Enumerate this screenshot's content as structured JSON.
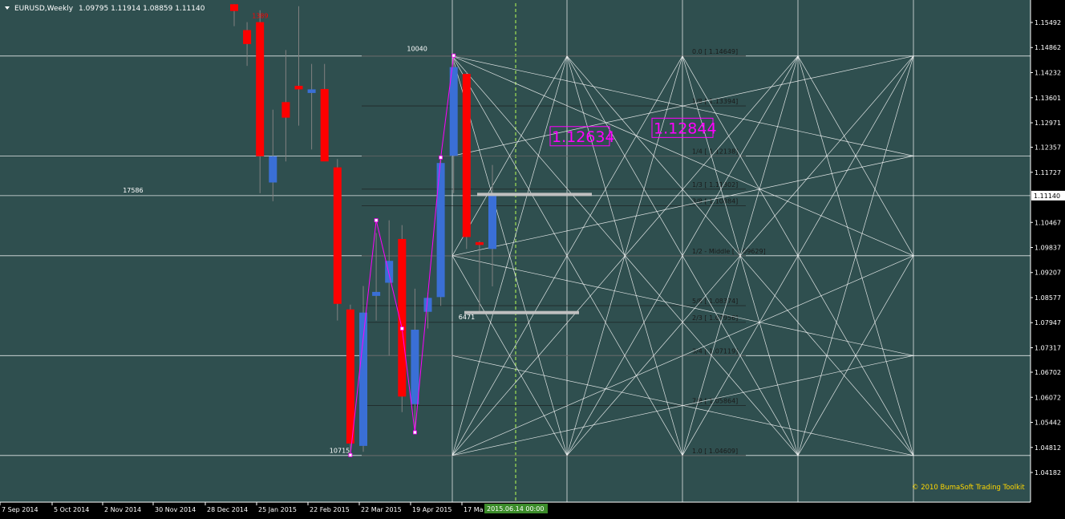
{
  "title": "EURUSD,Weekly",
  "ohlc_values": "1.09795 1.11914 1.08859 1.11140",
  "copyright": "© 2010 BumaSoft Trading Toolkit",
  "colors": {
    "background": "#2f4f4f",
    "grid": "#ffffff",
    "bull": "#3a6fd6",
    "bear": "#ff0000",
    "zigzag": "#ff00ff",
    "vline": "#b7ff55",
    "copyright": "#ffd700",
    "fibo": "#1a1a1a",
    "ask_tag_bg": "#ffffff",
    "date_tag_bg": "#3c8c2a"
  },
  "chart_data": {
    "type": "candlestick",
    "symbol": "EURUSD",
    "timeframe": "Weekly",
    "ylim": [
      1.041,
      1.1595
    ],
    "y_ticks": [
      "1.15492",
      "1.14862",
      "1.14232",
      "1.13601",
      "1.12971",
      "1.12357",
      "1.11727",
      "1.11140",
      "1.10467",
      "1.09837",
      "1.09207",
      "1.08577",
      "1.07947",
      "1.07317",
      "1.06702",
      "1.06072",
      "1.05442",
      "1.04812",
      "1.04182"
    ],
    "x_ticks": [
      "7 Sep 2014",
      "5 Oct 2014",
      "2 Nov 2014",
      "30 Nov 2014",
      "28 Dec 2014",
      "25 Jan 2015",
      "22 Feb 2015",
      "22 Mar 2015",
      "19 Apr 2015",
      "17 Ma"
    ],
    "current_price": "1.11140",
    "date_marker": "2015.06.14 00:00",
    "candles": [
      {
        "o": 1.1595,
        "h": 1.1595,
        "l": 1.154,
        "c": 1.1578
      },
      {
        "o": 1.153,
        "h": 1.155,
        "l": 1.144,
        "c": 1.1495
      },
      {
        "o": 1.155,
        "h": 1.158,
        "l": 1.112,
        "c": 1.1213
      },
      {
        "o": 1.1147,
        "h": 1.133,
        "l": 1.11,
        "c": 1.1213
      },
      {
        "o": 1.1349,
        "h": 1.148,
        "l": 1.12,
        "c": 1.131
      },
      {
        "o": 1.139,
        "h": 1.159,
        "l": 1.129,
        "c": 1.1381
      },
      {
        "o": 1.1372,
        "h": 1.1445,
        "l": 1.123,
        "c": 1.1381
      },
      {
        "o": 1.1382,
        "h": 1.1445,
        "l": 1.124,
        "c": 1.12
      },
      {
        "o": 1.1185,
        "h": 1.1206,
        "l": 1.08,
        "c": 1.0842
      },
      {
        "o": 1.0828,
        "h": 1.084,
        "l": 1.0462,
        "c": 1.0491
      },
      {
        "o": 1.0485,
        "h": 1.0887,
        "l": 1.047,
        "c": 1.082
      },
      {
        "o": 1.0862,
        "h": 1.102,
        "l": 1.08,
        "c": 1.0872
      },
      {
        "o": 1.0895,
        "h": 1.1052,
        "l": 1.0712,
        "c": 1.095
      },
      {
        "o": 1.1005,
        "h": 1.104,
        "l": 1.057,
        "c": 1.0609
      },
      {
        "o": 1.059,
        "h": 1.088,
        "l": 1.0519,
        "c": 1.0777
      },
      {
        "o": 1.0822,
        "h": 1.087,
        "l": 1.078,
        "c": 1.0857
      },
      {
        "o": 1.0859,
        "h": 1.121,
        "l": 1.0837,
        "c": 1.1196
      },
      {
        "o": 1.1214,
        "h": 1.1466,
        "l": 1.112,
        "c": 1.1437
      },
      {
        "o": 1.142,
        "h": 1.1425,
        "l": 1.098,
        "c": 1.101
      },
      {
        "o": 1.0997,
        "h": 1.1,
        "l": 1.0819,
        "c": 1.099
      },
      {
        "o": 1.098,
        "h": 1.1191,
        "l": 1.0886,
        "c": 1.1114
      }
    ],
    "zigzag": [
      {
        "i": 9,
        "price": 1.0462
      },
      {
        "i": 11,
        "price": 1.1052
      },
      {
        "i": 13,
        "price": 1.078
      },
      {
        "i": 14,
        "price": 1.0519
      },
      {
        "i": 16,
        "price": 1.121
      },
      {
        "i": 17,
        "price": 1.1466
      }
    ],
    "annotations": [
      {
        "text": "1389",
        "i": 2,
        "price": 1.1552,
        "color": "#ff0000"
      },
      {
        "text": "10040",
        "i": 14,
        "price": 1.147,
        "color": "#ffffff"
      },
      {
        "text": "17586",
        "i": -8,
        "price": 1.1114,
        "color": "#ffffff"
      },
      {
        "text": "10715",
        "i": 8,
        "price": 1.046,
        "color": "#ffffff"
      },
      {
        "text": "6471",
        "i": 18,
        "price": 1.0795,
        "color": "#ffffff"
      }
    ],
    "fibo_levels": [
      {
        "label": "0.0",
        "value": "1.14649",
        "price": 1.14649
      },
      {
        "label": "1/8",
        "value": "1.13394",
        "price": 1.13394
      },
      {
        "label": "1/4",
        "value": "1.12138",
        "price": 1.12138
      },
      {
        "label": "1/3",
        "value": "1.11302",
        "price": 1.11302
      },
      {
        "label": "3/8",
        "value": "1.10884",
        "price": 1.10884
      },
      {
        "label": "1/2 - Middle",
        "value": "1.09629",
        "price": 1.09629
      },
      {
        "label": "5/8",
        "value": "1.08374",
        "price": 1.08374
      },
      {
        "label": "2/3",
        "value": "1.07956",
        "price": 1.07956
      },
      {
        "label": "3/4",
        "value": "1.07119",
        "price": 1.07119
      },
      {
        "label": "7/8",
        "value": "1.05864",
        "price": 1.05864
      },
      {
        "label": "1.0",
        "value": "1.04609",
        "price": 1.04609
      }
    ],
    "price_labels": [
      {
        "text": "1.12634",
        "price": 1.12634
      },
      {
        "text": "1.12844",
        "price": 1.12844
      }
    ],
    "horizontal_grid": [
      1.14649,
      1.12138,
      1.1114,
      1.09629,
      1.07119,
      1.04609
    ]
  }
}
